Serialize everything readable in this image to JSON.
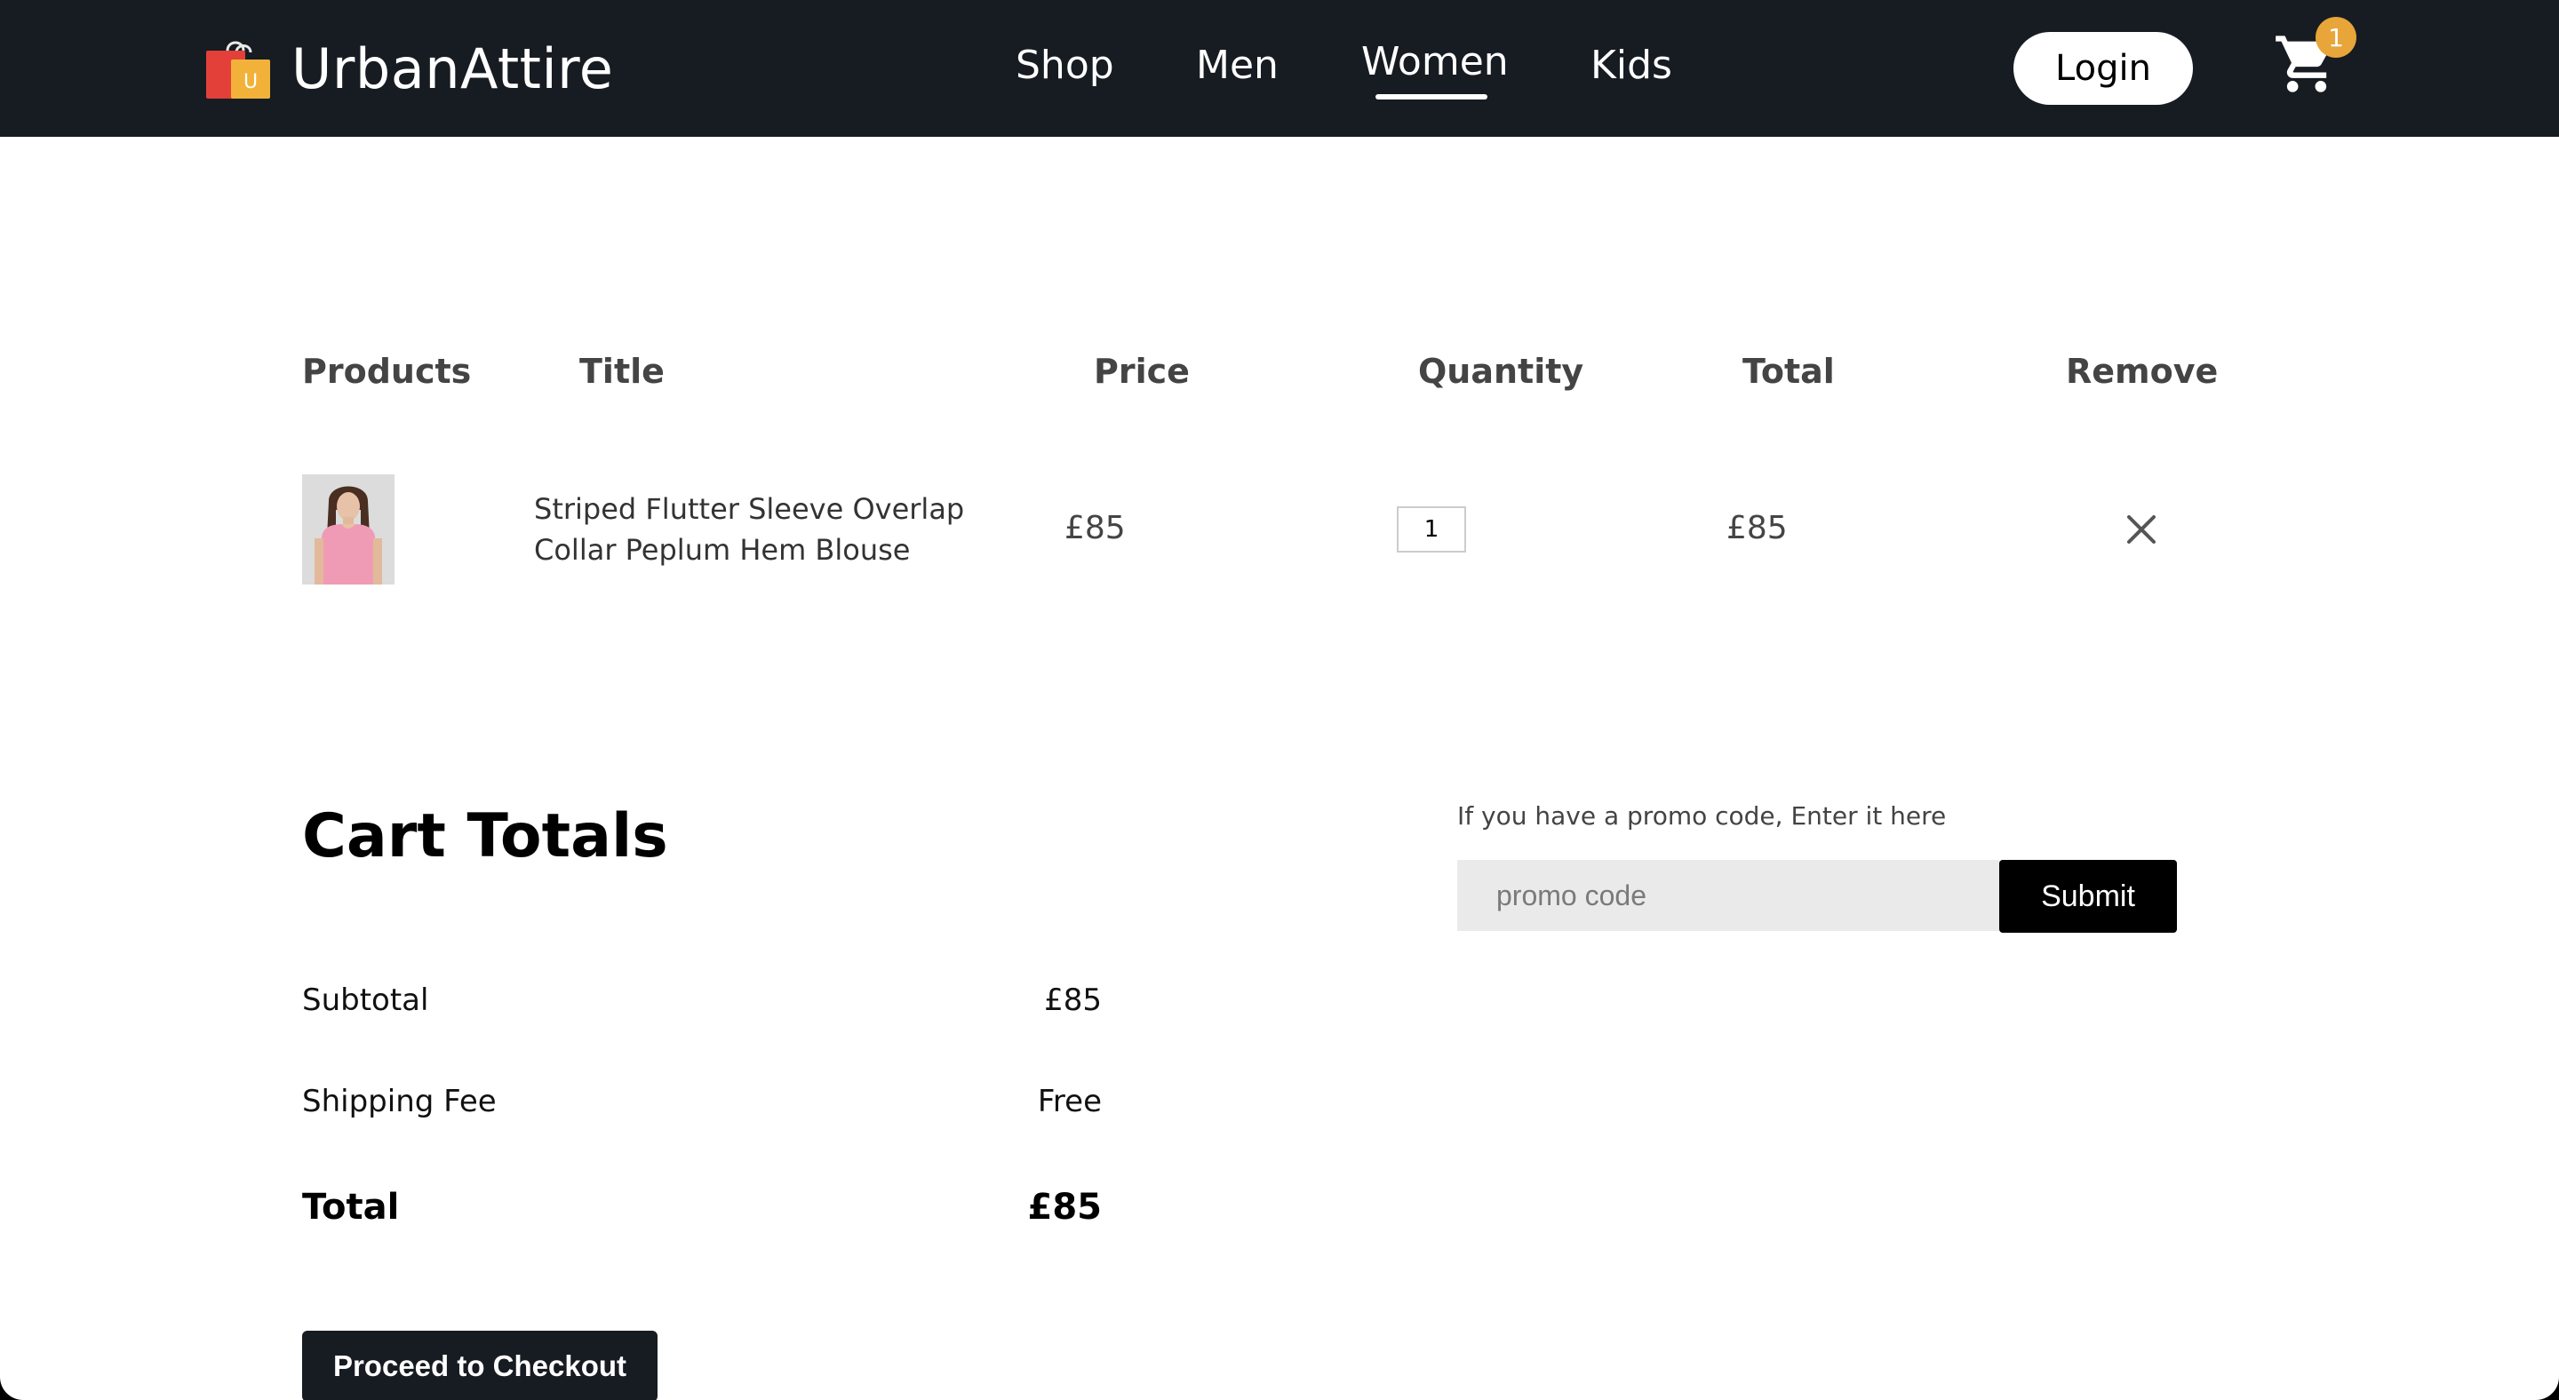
{
  "navbar": {
    "brand_name": "UrbanAttire",
    "logo_icon": "shopping-bag-icon",
    "logo_letter": "U",
    "links": [
      "Shop",
      "Men",
      "Women",
      "Kids"
    ],
    "active_link": "Women",
    "login_label": "Login",
    "cart_icon": "cart-icon",
    "cart_count": "1",
    "colors": {
      "background": "#171c22",
      "badge": "#e8a53a"
    }
  },
  "cart_table": {
    "headers": {
      "products": "Products",
      "title": "Title",
      "price": "Price",
      "quantity": "Quantity",
      "total": "Total",
      "remove": "Remove"
    },
    "items": [
      {
        "thumbnail": "product-photo-pink-blouse",
        "title": "Striped Flutter Sleeve Overlap Collar Peplum Hem Blouse",
        "price": "£85",
        "quantity": "1",
        "total": "£85",
        "remove_icon": "close-icon"
      }
    ]
  },
  "cart_totals": {
    "heading": "Cart Totals",
    "subtotal_label": "Subtotal",
    "subtotal_value": "£85",
    "shipping_label": "Shipping Fee",
    "shipping_value": "Free",
    "total_label": "Total",
    "total_value": "£85",
    "checkout_label": "Proceed to Checkout"
  },
  "promo": {
    "label": "If you have a promo code, Enter it here",
    "placeholder": "promo code",
    "value": "",
    "submit_label": "Submit"
  }
}
